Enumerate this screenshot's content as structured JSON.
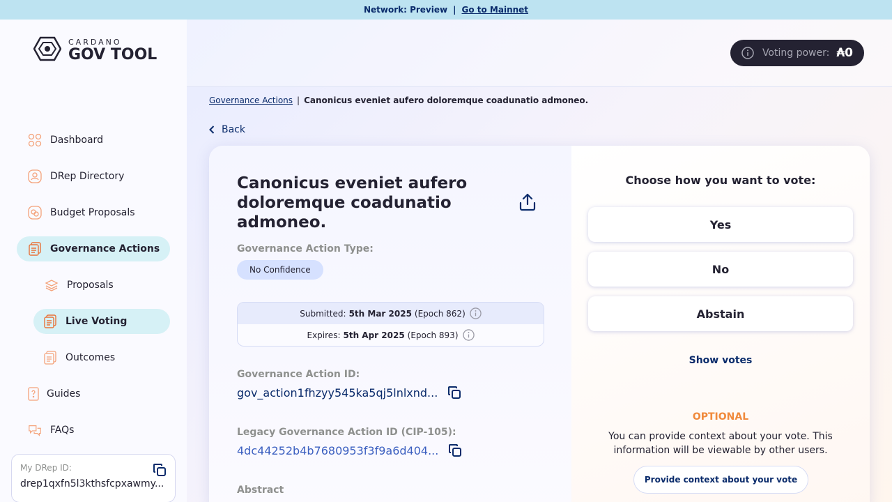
{
  "banner": {
    "network_label": "Network: Preview",
    "separator": "|",
    "mainnet_link": "Go to Mainnet"
  },
  "logo": {
    "small": "CARDANO",
    "big": "GOV TOOL"
  },
  "sidebar": {
    "items": [
      {
        "label": "Dashboard",
        "icon": "dashboard-icon"
      },
      {
        "label": "DRep Directory",
        "icon": "drep-directory-icon"
      },
      {
        "label": "Budget Proposals",
        "icon": "budget-proposals-icon"
      },
      {
        "label": "Governance Actions",
        "icon": "governance-actions-icon",
        "active": true
      },
      {
        "label": "Proposals",
        "icon": "proposals-icon"
      },
      {
        "label": "Live Voting",
        "icon": "live-voting-icon",
        "active": true
      },
      {
        "label": "Outcomes",
        "icon": "outcomes-icon"
      },
      {
        "label": "Guides",
        "icon": "guides-icon"
      },
      {
        "label": "FAQs",
        "icon": "faqs-icon"
      }
    ],
    "drep": {
      "label": "My DRep ID:",
      "value": "drep1qxfn5l3kthsfcpxawmy..."
    }
  },
  "header": {
    "voting_power_label": "Voting power:",
    "voting_power_value": "₳0"
  },
  "breadcrumb": {
    "parent": "Governance Actions",
    "separator": "|",
    "current": "Canonicus eveniet aufero doloremque coadunatio admoneo."
  },
  "back_label": "Back",
  "action": {
    "title": "Canonicus eveniet aufero doloremque coadunatio admoneo.",
    "type_label": "Governance Action Type:",
    "type_value": "No Confidence",
    "submitted_label": "Submitted:",
    "submitted_date": "5th Mar 2025",
    "submitted_epoch": "(Epoch 862)",
    "expires_label": "Expires:",
    "expires_date": "5th Apr 2025",
    "expires_epoch": "(Epoch 893)",
    "id_label": "Governance Action ID:",
    "id_value": "gov_action1fhzyy545ka5qj5lnlxnd...",
    "legacy_id_label": "Legacy Governance Action ID (CIP-105):",
    "legacy_id_value": "4dc44252b4b7680953f3f9a6d404...",
    "abstract_label": "Abstract"
  },
  "vote": {
    "title": "Choose how you want to vote:",
    "yes": "Yes",
    "no": "No",
    "abstain": "Abstain",
    "show_votes": "Show votes",
    "optional": "OPTIONAL",
    "context_text": "You can provide context about your vote. This information will be viewable by other users.",
    "context_button": "Provide context about your vote"
  },
  "colors": {
    "accent": "#0a2b6b",
    "banner": "#bde3f1",
    "active_nav": "#d6f1f6",
    "optional": "#f08a3c",
    "nav_icon": "#f4a27a"
  }
}
